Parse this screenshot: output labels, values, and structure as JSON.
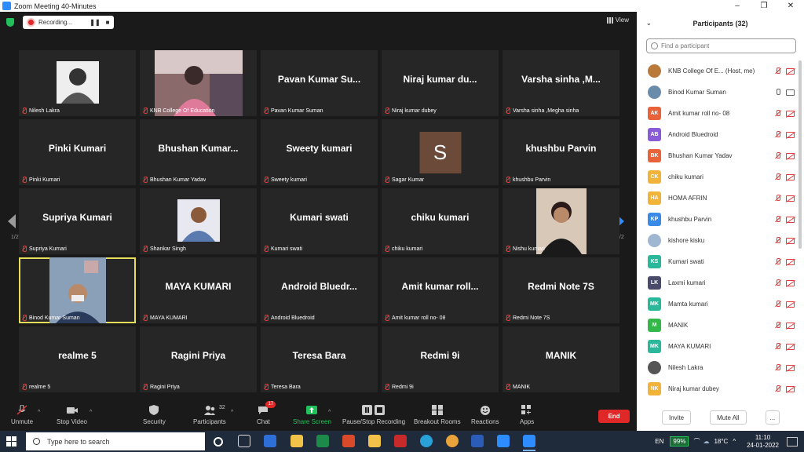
{
  "window": {
    "title": "Zoom Meeting 40-Minutes",
    "minimize": "–",
    "maximize": "❐",
    "close": "✕"
  },
  "meeting": {
    "recording_label": "Recording...",
    "pause_glyph": "❚❚",
    "stop_glyph": "■",
    "view_label": "View",
    "page_left": "1/2",
    "page_right": "1/2",
    "tiles": [
      {
        "display": "",
        "tag": "Nilesh Lakra",
        "photo": "bw"
      },
      {
        "display": "",
        "tag": "KNB College Of Education",
        "photo": "room"
      },
      {
        "display": "Pavan Kumar Su...",
        "tag": "Pavan Kumar Suman"
      },
      {
        "display": "Niraj kumar du...",
        "tag": "Niraj kumar dubey"
      },
      {
        "display": "Varsha sinha ,M...",
        "tag": "Varsha sinha ,Megha sinha"
      },
      {
        "display": "Pinki Kumari",
        "tag": "Pinki Kumari"
      },
      {
        "display": "Bhushan  Kumar...",
        "tag": "Bhushan Kumar Yadav"
      },
      {
        "display": "Sweety kumari",
        "tag": "Sweety kumari"
      },
      {
        "display": "",
        "tag": "Sagar Kumar",
        "letter": "S"
      },
      {
        "display": "khushbu Parvin",
        "tag": "khushbu Parvin"
      },
      {
        "display": "Supriya Kumari",
        "tag": "Supriya Kumari"
      },
      {
        "display": "",
        "tag": "Shankar Singh",
        "photo": "man"
      },
      {
        "display": "Kumari swati",
        "tag": "Kumari swati"
      },
      {
        "display": "chiku kumari",
        "tag": "chiku kumari"
      },
      {
        "display": "",
        "tag": "Nishu kumari",
        "photo": "girl"
      },
      {
        "display": "",
        "tag": "Binod Kumar Suman",
        "photo": "video",
        "active": true
      },
      {
        "display": "MAYA KUMARI",
        "tag": "MAYA KUMARI"
      },
      {
        "display": "Android  Bluedr...",
        "tag": "Android Bluedroid"
      },
      {
        "display": "Amit  kumar  roll...",
        "tag": "Amit kumar roll no- 08"
      },
      {
        "display": "Redmi Note 7S",
        "tag": "Redmi Note 7S"
      },
      {
        "display": "realme 5",
        "tag": "realme 5"
      },
      {
        "display": "Ragini  Priya",
        "tag": "Ragini  Priya"
      },
      {
        "display": "Teresa Bara",
        "tag": "Teresa Bara"
      },
      {
        "display": "Redmi 9i",
        "tag": "Redmi 9i"
      },
      {
        "display": "MANIK",
        "tag": "MANIK"
      }
    ]
  },
  "toolbar": {
    "unmute": "Unmute",
    "stop_video": "Stop Video",
    "security": "Security",
    "participants": "Participants",
    "participants_count": "32",
    "chat": "Chat",
    "chat_badge": "17",
    "share_screen": "Share Screen",
    "pause_stop_recording": "Pause/Stop Recording",
    "breakout_rooms": "Breakout Rooms",
    "reactions": "Reactions",
    "apps": "Apps",
    "end": "End",
    "caret": "^"
  },
  "panel": {
    "title": "Participants (32)",
    "search_placeholder": "Find a participant",
    "invite": "Invite",
    "mute_all": "Mute All",
    "more": "...",
    "participants": [
      {
        "name": "KNB College Of E...  (Host, me)",
        "initials": "",
        "color": "#b97a3a",
        "photo": true,
        "self": true
      },
      {
        "name": "Binod Kumar Suman",
        "initials": "",
        "color": "#6a8caa",
        "photo": true,
        "live": true
      },
      {
        "name": "Amit kumar roll no- 08",
        "initials": "AK",
        "color": "#e8633a"
      },
      {
        "name": "Android Bluedroid",
        "initials": "AB",
        "color": "#8a5bd6"
      },
      {
        "name": "Bhushan Kumar Yadav",
        "initials": "BK",
        "color": "#e8633a"
      },
      {
        "name": "chiku kumari",
        "initials": "CK",
        "color": "#f2b33a"
      },
      {
        "name": "HOMA AFRIN",
        "initials": "HA",
        "color": "#f2b33a"
      },
      {
        "name": "khushbu Parvin",
        "initials": "KP",
        "color": "#3a8ae8"
      },
      {
        "name": "kishore kisku",
        "initials": "",
        "color": "#9fb7d0",
        "photo": true
      },
      {
        "name": "Kumari swati",
        "initials": "KS",
        "color": "#2bb89a"
      },
      {
        "name": "Laxmi kumari",
        "initials": "LK",
        "color": "#4a4a6a"
      },
      {
        "name": "Mamta kumari",
        "initials": "MK",
        "color": "#2bb89a"
      },
      {
        "name": "MANIK",
        "initials": "M",
        "color": "#35b84a"
      },
      {
        "name": "MAYA KUMARI",
        "initials": "MK",
        "color": "#2bb89a"
      },
      {
        "name": "Nilesh Lakra",
        "initials": "",
        "color": "#555",
        "photo": true
      },
      {
        "name": "Niraj kumar dubey",
        "initials": "NK",
        "color": "#f2b33a"
      }
    ]
  },
  "taskbar": {
    "search_placeholder": "Type here to search",
    "lang": "EN",
    "battery": "99%",
    "weather": "18°C",
    "time": "11:10",
    "date": "24-01-2022"
  }
}
